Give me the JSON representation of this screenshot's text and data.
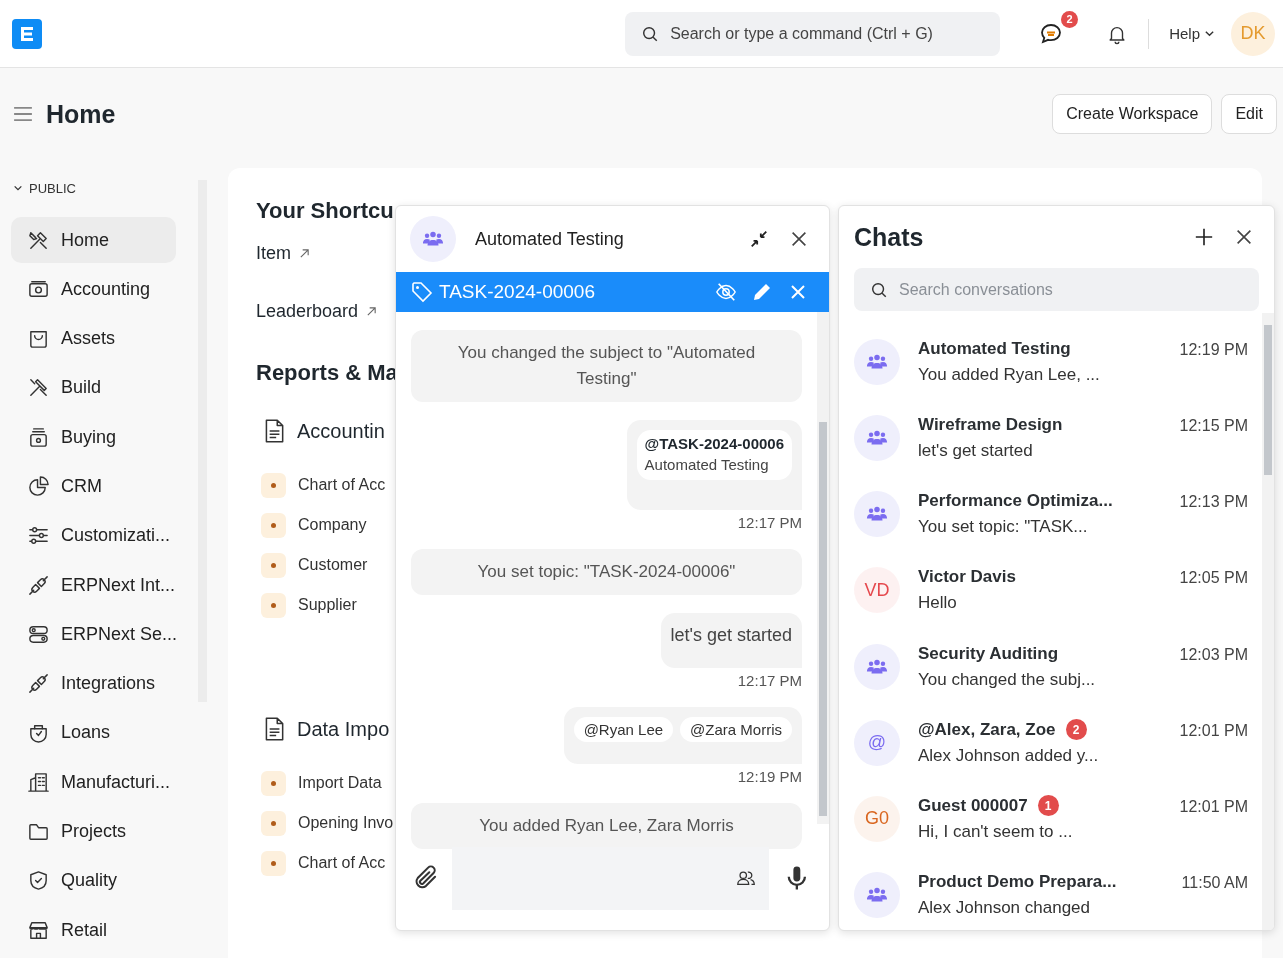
{
  "search": {
    "placeholder": "Search or type a command (Ctrl + G)"
  },
  "chat_badge": "2",
  "help": "Help",
  "user_initials": "DK",
  "page": {
    "title": "Home",
    "buttons": [
      "Create Workspace",
      "Edit"
    ]
  },
  "sidebar": {
    "section": "PUBLIC",
    "expanded": true,
    "items": [
      {
        "label": "Home",
        "selected": true
      },
      {
        "label": "Accounting",
        "selected": false
      },
      {
        "label": "Assets",
        "selected": false
      },
      {
        "label": "Build",
        "selected": false
      },
      {
        "label": "Buying",
        "selected": false
      },
      {
        "label": "CRM",
        "selected": false
      },
      {
        "label": "Customizati...",
        "selected": false
      },
      {
        "label": "ERPNext Int...",
        "selected": false
      },
      {
        "label": "ERPNext Se...",
        "selected": false
      },
      {
        "label": "Integrations",
        "selected": false
      },
      {
        "label": "Loans",
        "selected": false
      },
      {
        "label": "Manufacturi...",
        "selected": false
      },
      {
        "label": "Projects",
        "selected": false
      },
      {
        "label": "Quality",
        "selected": false
      },
      {
        "label": "Retail",
        "selected": false
      }
    ]
  },
  "shortcuts": {
    "title": "Your Shortcu",
    "items": [
      "Item",
      "Leaderboard"
    ]
  },
  "reports": {
    "title": "Reports & Ma",
    "cards": [
      {
        "title": "Accountin",
        "links": [
          "Chart of Acc",
          "Company",
          "Customer",
          "Supplier"
        ]
      },
      {
        "title": "Data Impo",
        "links": [
          "Import Data",
          "Opening Invo",
          "Chart of Acc"
        ]
      }
    ]
  },
  "chat_window": {
    "title": "Automated Testing",
    "topic": "TASK-2024-00006",
    "messages": [
      {
        "kind": "system",
        "text": "You changed the subject to \"Automated Testing\""
      },
      {
        "kind": "mention_card",
        "mention": "@TASK-2024-00006",
        "subtitle": "Automated Testing",
        "time": "12:17 PM"
      },
      {
        "kind": "system",
        "text": "You set topic: \"TASK-2024-00006\""
      },
      {
        "kind": "text",
        "text": "let's get started",
        "time": "12:17 PM"
      },
      {
        "kind": "mentions",
        "mentions": [
          "@Ryan Lee",
          "@Zara Morris"
        ],
        "time": "12:19 PM"
      },
      {
        "kind": "system",
        "text": "You added Ryan Lee, Zara Morris"
      }
    ]
  },
  "chats": {
    "title": "Chats",
    "search_placeholder": "Search conversations",
    "conversations": [
      {
        "kind": "group",
        "name": "Automated Testing",
        "preview": "You added Ryan Lee, ...",
        "time": "12:19 PM"
      },
      {
        "kind": "group",
        "name": "Wireframe Design",
        "preview": "let's get started",
        "time": "12:15 PM"
      },
      {
        "kind": "group",
        "name": "Performance Optimiza...",
        "preview": "You set topic: \"TASK...",
        "time": "12:13 PM"
      },
      {
        "kind": "initials",
        "initials": "VD",
        "color": "#e5484d",
        "name": "Victor Davis",
        "preview": "Hello",
        "time": "12:05 PM"
      },
      {
        "kind": "group",
        "name": "Security Auditing",
        "preview": "You changed the subj...",
        "time": "12:03 PM"
      },
      {
        "kind": "mention",
        "initials": "@",
        "name": "@Alex, Zara, Zoe",
        "unread": "2",
        "preview": "Alex Johnson added y...",
        "time": "12:01 PM"
      },
      {
        "kind": "initials",
        "initials": "G0",
        "color": "#d9661f",
        "name": "Guest 000007",
        "unread": "1",
        "preview": "Hi, I can't seem to ...",
        "time": "12:01 PM"
      },
      {
        "kind": "group",
        "name": "Product Demo Prepara...",
        "preview": "Alex Johnson changed",
        "time": "11:50 AM"
      }
    ]
  }
}
